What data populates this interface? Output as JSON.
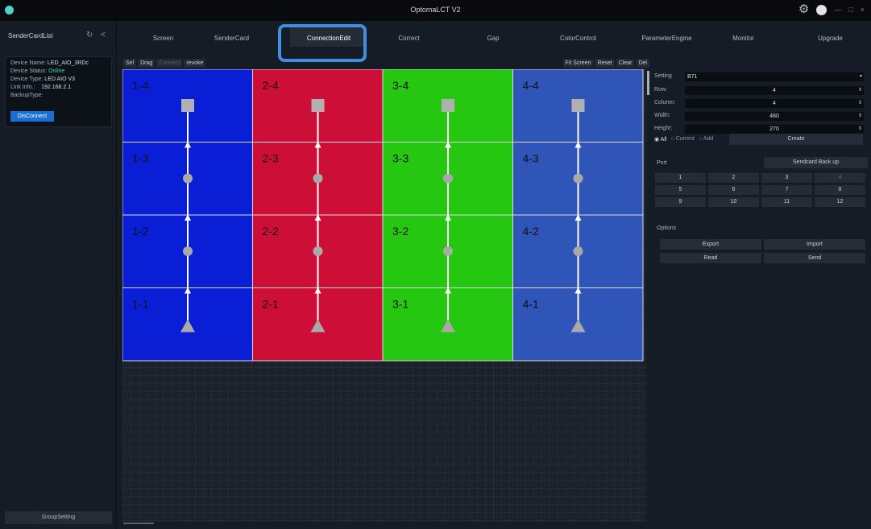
{
  "app": {
    "title": "OptomaLCT V2",
    "window_controls": [
      "—",
      "□",
      "×"
    ]
  },
  "left_panel": {
    "header": "SenderCardList",
    "refresh_icon": "↻",
    "back_icon": "<",
    "device": {
      "name_label": "Device Name:",
      "name_value": "LED_AIO_3RDc",
      "status_label": "Device Status:",
      "status_value": "Online",
      "type_label": "Device Type:",
      "type_value": "LED AIO V3",
      "link_label": "Link Info.:",
      "link_value": "192.168.2.1",
      "backup_label": "BackupType:"
    },
    "disconnect_label": "DisConnect",
    "group_setting_label": "GroupSetting"
  },
  "tabs": [
    {
      "label": "Screen",
      "active": false
    },
    {
      "label": "SenderCard",
      "active": false
    },
    {
      "label": "ConnectionEdit",
      "active": true
    },
    {
      "label": "Correct",
      "active": false
    },
    {
      "label": "Gap",
      "active": false
    },
    {
      "label": "ColorControl",
      "active": false
    },
    {
      "label": "ParameterEngine",
      "active": false
    },
    {
      "label": "Monitor",
      "active": false
    },
    {
      "label": "Upgrade",
      "active": false
    }
  ],
  "toolbar_left": [
    "Sel",
    "Drag",
    "Connect",
    "revoke"
  ],
  "toolbar_right": [
    "Fit Screen",
    "Reset",
    "Clear",
    "Del"
  ],
  "grid": {
    "columns": 4,
    "rows": 4,
    "colors": [
      "#0a1ed6",
      "#cd0f38",
      "#26c710",
      "#2f55b8"
    ],
    "cells": [
      [
        "1-4",
        "2-4",
        "3-4",
        "4-4"
      ],
      [
        "1-3",
        "2-3",
        "3-3",
        "4-3"
      ],
      [
        "1-2",
        "2-2",
        "3-2",
        "4-2"
      ],
      [
        "1-1",
        "2-1",
        "3-1",
        "4-1"
      ]
    ]
  },
  "settings": {
    "setting_label": "Setting",
    "setting_value": "B71",
    "row_label": "Row:",
    "row_value": "4",
    "column_label": "Column:",
    "column_value": "4",
    "width_label": "Width:",
    "width_value": "480",
    "height_label": "Height:",
    "height_value": "270",
    "radio_all": "All",
    "radio_current": "Current",
    "radio_add": "Add",
    "create_label": "Create"
  },
  "port_section": {
    "label": "Port",
    "backup_label": "Sendcard Back up",
    "ports": [
      "1",
      "2",
      "3",
      "4",
      "5",
      "6",
      "7",
      "8",
      "9",
      "10",
      "11",
      "12"
    ]
  },
  "options": {
    "label": "Options",
    "export_label": "Export",
    "import_label": "Import",
    "read_label": "Read",
    "send_label": "Send"
  }
}
